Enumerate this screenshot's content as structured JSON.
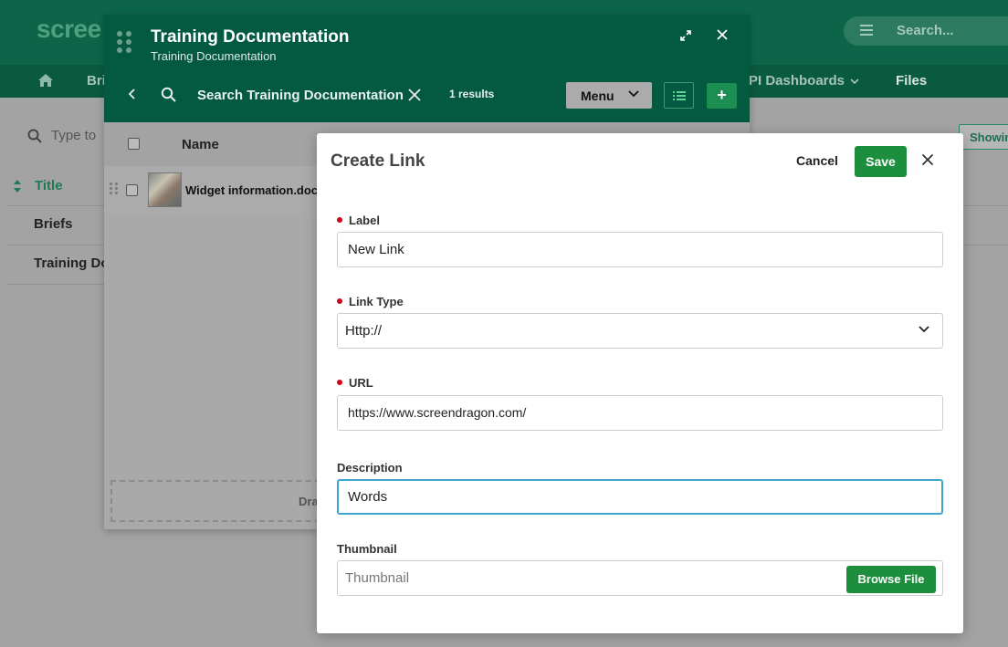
{
  "background": {
    "logo": "scree",
    "search_placeholder": "Search...",
    "nav": {
      "brief": "Bri",
      "kpi": "PI Dashboards",
      "files": "Files"
    },
    "filter_placeholder": "Type to",
    "showing": "Showin",
    "table": {
      "title_header": "Title",
      "rows": [
        "Briefs",
        "Training Do"
      ]
    }
  },
  "panel": {
    "title": "Training Documentation",
    "subtitle": "Training Documentation",
    "search_text": "Search Training Documentation",
    "results": "1 results",
    "menu_label": "Menu",
    "add_label": "+",
    "column_name": "Name",
    "file_name": "Widget information.doc",
    "drop_text": "Dra"
  },
  "dialog": {
    "title": "Create Link",
    "cancel": "Cancel",
    "save": "Save",
    "fields": {
      "label": {
        "label": "Label",
        "value": "New Link"
      },
      "link_type": {
        "label": "Link Type",
        "value": "Http://"
      },
      "url": {
        "label": "URL",
        "value": "https://www.screendragon.com/"
      },
      "description": {
        "label": "Description",
        "value": "Words"
      },
      "thumbnail": {
        "label": "Thumbnail",
        "placeholder": "Thumbnail",
        "button": "Browse File"
      }
    }
  },
  "colors": {
    "brand_green": "#035a41",
    "action_green": "#1c8e3d",
    "required_red": "#d0021b",
    "focus_blue": "#3ea6cf"
  }
}
